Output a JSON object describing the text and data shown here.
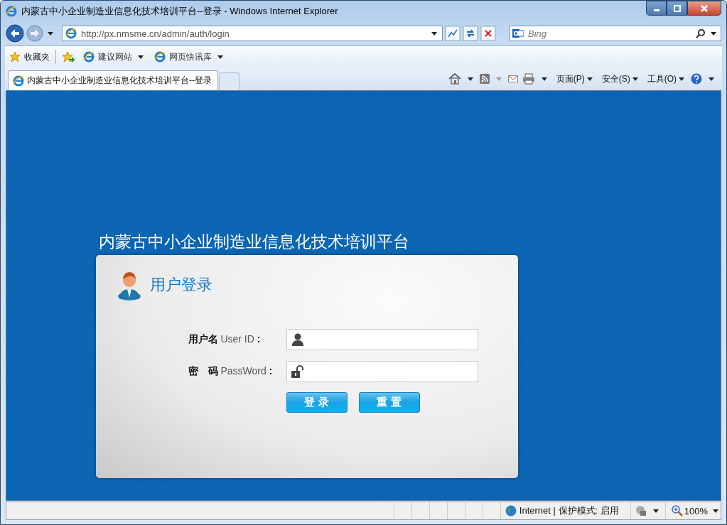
{
  "window": {
    "title": "内蒙古中小企业制造业信息化技术培训平台--登录 - Windows Internet Explorer"
  },
  "address_bar": {
    "url": "http://px.nmsme.cn/admin/auth/login"
  },
  "search": {
    "placeholder": "Bing"
  },
  "favorites_bar": {
    "items": [
      {
        "label": "收藏夹",
        "kind": "favorites"
      },
      {
        "label": "建议网站",
        "kind": "link"
      },
      {
        "label": "网页快讯库",
        "kind": "link"
      }
    ]
  },
  "tabs": [
    {
      "label": "内蒙古中小企业制造业信息化技术培训平台--登录",
      "selected": true
    }
  ],
  "command_bar": [
    "页面(P)",
    "安全(S)",
    "工具(O)"
  ],
  "page": {
    "heading": "内蒙古中小企业制造业信息化技术培训平台",
    "panel_title": "用户登录",
    "fields": [
      {
        "label": "**用户名** User ID **:**",
        "kind": "user"
      },
      {
        "label": "**密　码** PassWord **:**",
        "kind": "password"
      }
    ],
    "buttons": [
      "登 录",
      "重 置"
    ]
  },
  "status_bar": {
    "zone": "Internet | 保护模式: 启用",
    "zoom": "100%"
  }
}
